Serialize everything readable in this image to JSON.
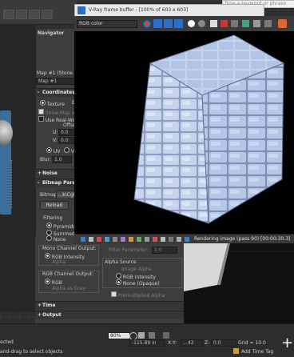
{
  "top_right": {
    "search_placeholder": "Type a keyword or phrase"
  },
  "left": {
    "bottom_text": "ected",
    "prompt": "and-drag to select objects"
  },
  "navigator": {
    "title": "Navigator"
  },
  "material": {
    "name_label": "Map #1 (Stone Wal...",
    "name_value": "Map #1",
    "coordinates": {
      "title": "Coordinates",
      "texture": "Texture",
      "env_short": "E",
      "show_map": "Show Map on B",
      "real_world": "Use Real-World S",
      "offset": "Offset",
      "u_label": "U:",
      "u_value": "0.0",
      "v_label": "V:",
      "v_value": "0.0",
      "uv": "UV",
      "vw": "VW",
      "blur_label": "Blur:",
      "blur_value": "1.0"
    },
    "noise": {
      "title": "Noise"
    },
    "bitmap": {
      "title": "Bitmap Paramet",
      "bitmap_label": "Bitmap:",
      "bitmap_value": "...k\\Cgi",
      "reload": "Reload",
      "filtering": "Filtering",
      "filter_options": [
        "Pyramidal",
        "Summed Are",
        "None"
      ]
    },
    "mono": {
      "title": "Mono Channel Output:",
      "rgb_intensity": "RGB Intensity",
      "alpha": "Alpha"
    },
    "rgb": {
      "title": "RGB Channel Output:",
      "rgb": "RGB",
      "alpha_gray": "Alpha as Gray"
    },
    "alpha_source": {
      "title": "Alpha Source",
      "options": [
        "Image Alpha",
        "RGB Intensity",
        "None (Opaque)"
      ],
      "premult": "Premultiplied Alpha"
    },
    "filter_param": {
      "label": "Filter Parameter:",
      "value": "1.0"
    },
    "time": {
      "title": "Time"
    },
    "output": {
      "title": "Output"
    }
  },
  "framebuffer": {
    "title": "V-Ray frame buffer - [100% of 603 x 603]",
    "channel": "RGB color",
    "status": "Rendering image (pass 90) [00:00:30.3]"
  },
  "statusbar": {
    "zoom": "80%",
    "x_label": "X:",
    "x_value": "-115.89 in",
    "y_label": "Y:",
    "y_value": "...43",
    "z_label": "Z:",
    "z_value": "0.0",
    "grid": "Grid = 10.0",
    "add_time_tag": "Add Time Tag"
  },
  "colors": {
    "accent": "#2d6cc7",
    "stone": "#b8c9e8"
  }
}
